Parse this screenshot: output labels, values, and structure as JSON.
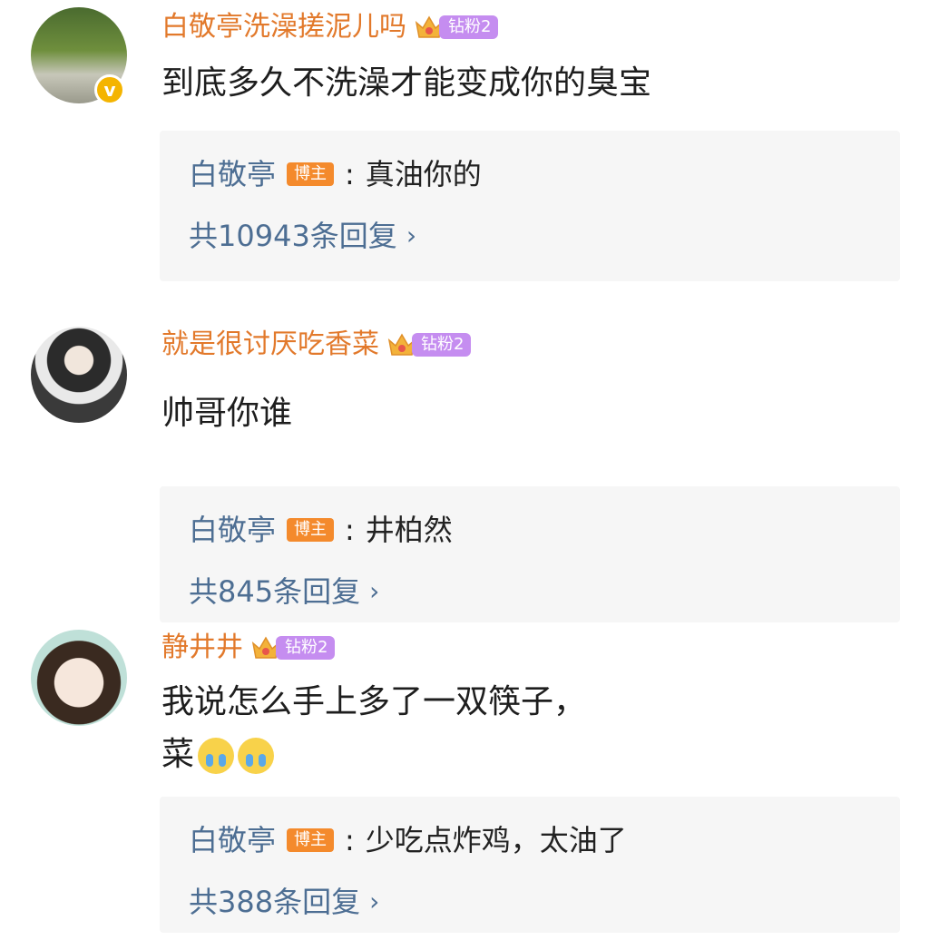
{
  "icons": {
    "verified": "verified-icon",
    "crown": "crown-icon",
    "chevron": "chevron-right-icon",
    "crying": "crying-emoji-icon"
  },
  "colors": {
    "username": "#e2792b",
    "reply_author": "#4d6e93",
    "blogger_tag": "#f48a2c",
    "fan_badge": "#c58df0",
    "reply_bg": "#f6f6f6"
  },
  "comments": [
    {
      "username": "白敬亭洗澡搓泥儿吗",
      "fan_badge": "钻粉2",
      "verified_mark": "v",
      "text": "到底多久不洗澡才能变成你的臭宝",
      "reply": {
        "author": "白敬亭",
        "tag": "博主",
        "colon": ":",
        "text": "真油你的",
        "count": "共10943条回复",
        "chevron": "›"
      }
    },
    {
      "username": "就是很讨厌吃香菜",
      "fan_badge": "钻粉2",
      "text": "帅哥你谁",
      "reply": {
        "author": "白敬亭",
        "tag": "博主",
        "colon": ":",
        "text": "井柏然",
        "count": "共845条回复",
        "chevron": "›"
      }
    },
    {
      "username": "静井井",
      "fan_badge": "钻粉2",
      "text_line1": "我说怎么手上多了一双筷子，",
      "text_line2": "菜",
      "reply": {
        "author": "白敬亭",
        "tag": "博主",
        "colon": ":",
        "text": "少吃点炸鸡，太油了",
        "count": "共388条回复",
        "chevron": "›"
      }
    }
  ]
}
